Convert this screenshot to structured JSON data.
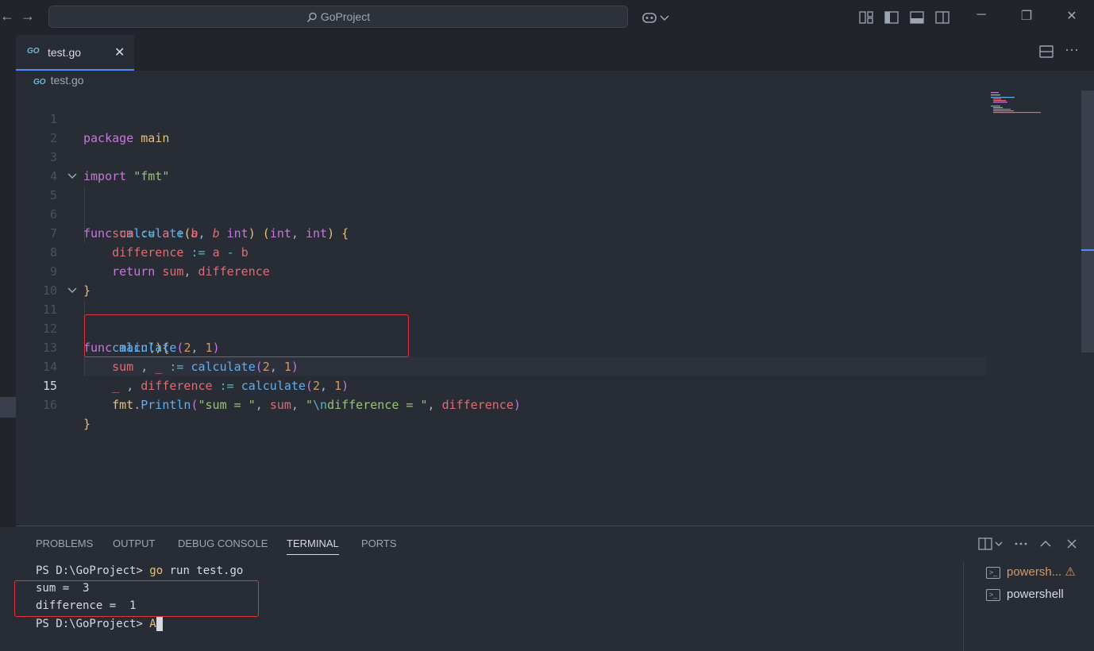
{
  "titlebar": {
    "search_text": "GoProject",
    "nav_back": "←",
    "nav_forward": "→",
    "win_min": "─",
    "win_max": "❐",
    "win_close": "✕"
  },
  "tab": {
    "badge": "GO",
    "label": "test.go",
    "close": "✕"
  },
  "breadcrumb": {
    "badge": "GO",
    "file": "test.go"
  },
  "editor_actions": {
    "split": "◫",
    "more": "···"
  },
  "code": {
    "line_numbers": [
      "1",
      "2",
      "3",
      "4",
      "5",
      "6",
      "7",
      "8",
      "9",
      "10",
      "11",
      "12",
      "13",
      "14",
      "15",
      "16"
    ],
    "l1_kw": "package",
    "l1_pkg": "main",
    "l3_kw": "import",
    "l3_str": "\"fmt\"",
    "l5_kw": "func",
    "l5_fn": "calculate",
    "l5_p1": "a",
    "l5_p2": "b",
    "l5_t1": "int",
    "l5_t2": "int",
    "l5_t3": "int",
    "l6_var": "sum",
    "l6_op": ":=",
    "l6_a": "a",
    "l6_plus": "+",
    "l6_b": "b",
    "l7_var": "difference",
    "l7_op": ":=",
    "l7_a": "a",
    "l7_minus": "-",
    "l7_b": "b",
    "l8_kw": "return",
    "l8_v1": "sum",
    "l8_v2": "difference",
    "l9": "}",
    "l11_kw": "func",
    "l11_fn": "main",
    "l12_fn": "calculate",
    "l12_n1": "2",
    "l12_n2": "1",
    "l13_var": "sum",
    "l13_blank": "_",
    "l13_op": ":=",
    "l13_fn": "calculate",
    "l13_n1": "2",
    "l13_n2": "1",
    "l14_blank": "_",
    "l14_var": "difference",
    "l14_op": ":=",
    "l14_fn": "calculate",
    "l14_n1": "2",
    "l14_n2": "1",
    "l15_pkg": "fmt",
    "l15_fn": "Println",
    "l15_s1": "\"sum = \"",
    "l15_v1": "sum",
    "l15_s2a": "\"",
    "l15_esc": "\\n",
    "l15_s2b": "difference = \"",
    "l15_v2": "difference",
    "l16": "}"
  },
  "panel": {
    "tabs": [
      "PROBLEMS",
      "OUTPUT",
      "DEBUG CONSOLE",
      "TERMINAL",
      "PORTS"
    ],
    "active_tab": "TERMINAL",
    "terminal": {
      "prompt1": "PS D:\\GoProject> ",
      "cmd_go": "go",
      "cmd_rest": " run test.go",
      "out1": "sum =  3",
      "out2": "difference =  1",
      "prompt2": "PS D:\\GoProject> ",
      "cursor_char": "A"
    },
    "terminal_list": [
      {
        "label": "powersh...",
        "warning": true
      },
      {
        "label": "powershell",
        "warning": false
      }
    ],
    "warn_icon": "⚠"
  },
  "colors": {
    "accent": "#528bff",
    "highlight_box": "#e0353b",
    "editor_bg": "#282c34"
  }
}
